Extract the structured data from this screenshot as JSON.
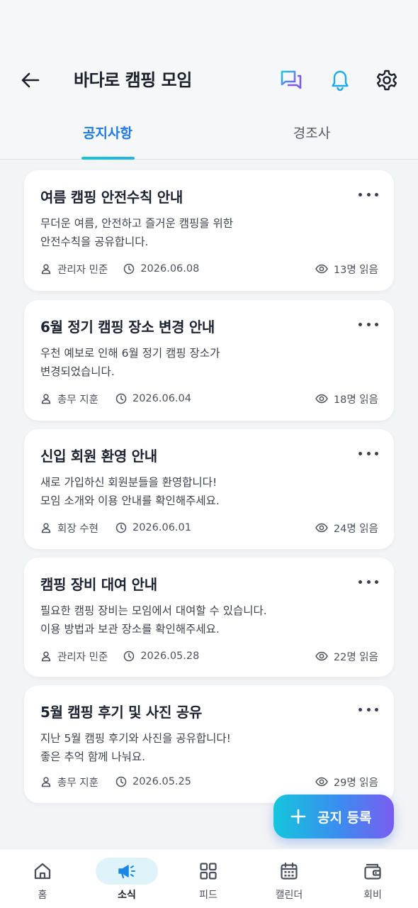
{
  "header": {
    "title": "바다로 캠핑 모임",
    "icons": [
      "arrow-left-icon",
      "chat-icon",
      "bell-icon",
      "gear-icon"
    ]
  },
  "tabs": [
    {
      "label": "공지사항",
      "active": true
    },
    {
      "label": "경조사",
      "active": false
    }
  ],
  "notices": [
    {
      "title": "여름 캠핑 안전수칙 안내",
      "body": [
        "무더운 여름, 안전하고 즐거운 캠핑을 위한",
        "안전수칙을 공유합니다."
      ],
      "author": "관리자 민준",
      "date": "2026.06.08",
      "views": "13명 읽음"
    },
    {
      "title": "6월 정기 캠핑 장소 변경 안내",
      "body": [
        "우천 예보로 인해 6월 정기 캠핑 장소가",
        "변경되었습니다."
      ],
      "author": "총무 지훈",
      "date": "2026.06.04",
      "views": "18명 읽음"
    },
    {
      "title": "신입 회원 환영 안내",
      "body": [
        "새로 가입하신 회원분들을 환영합니다!",
        "모임 소개와 이용 안내를 확인해주세요."
      ],
      "author": "회장 수현",
      "date": "2026.06.01",
      "views": "24명 읽음"
    },
    {
      "title": "캠핑 장비 대여 안내",
      "body": [
        "필요한 캠핑 장비는 모임에서 대여할 수 있습니다.",
        "이용 방법과 보관 장소를 확인해주세요."
      ],
      "author": "관리자 민준",
      "date": "2026.05.28",
      "views": "22명 읽음"
    },
    {
      "title": "5월 캠핑 후기 및 사진 공유",
      "body": [
        "지난 5월 캠핑 후기와 사진을 공유합니다!",
        "좋은 추억 함께 나눠요."
      ],
      "author": "총무 지훈",
      "date": "2026.05.25",
      "views": "29명 읽음"
    }
  ],
  "fab": {
    "label": "공지 등록",
    "icon": "plus-icon"
  },
  "bottom_nav": [
    {
      "label": "홈",
      "icon": "home-icon",
      "active": false
    },
    {
      "label": "소식",
      "icon": "megaphone-icon",
      "active": true
    },
    {
      "label": "피드",
      "icon": "grid-icon",
      "active": false
    },
    {
      "label": "캘린더",
      "icon": "calendar-icon",
      "active": false
    },
    {
      "label": "회비",
      "icon": "wallet-icon",
      "active": false
    }
  ],
  "colors": {
    "accent": "#1f7ae0",
    "tab_underline": "#16c4d8",
    "chat_icon": "#7b5cf0",
    "bell_icon": "#1ea8f0",
    "nav_active_bg": "#dff3fb"
  }
}
